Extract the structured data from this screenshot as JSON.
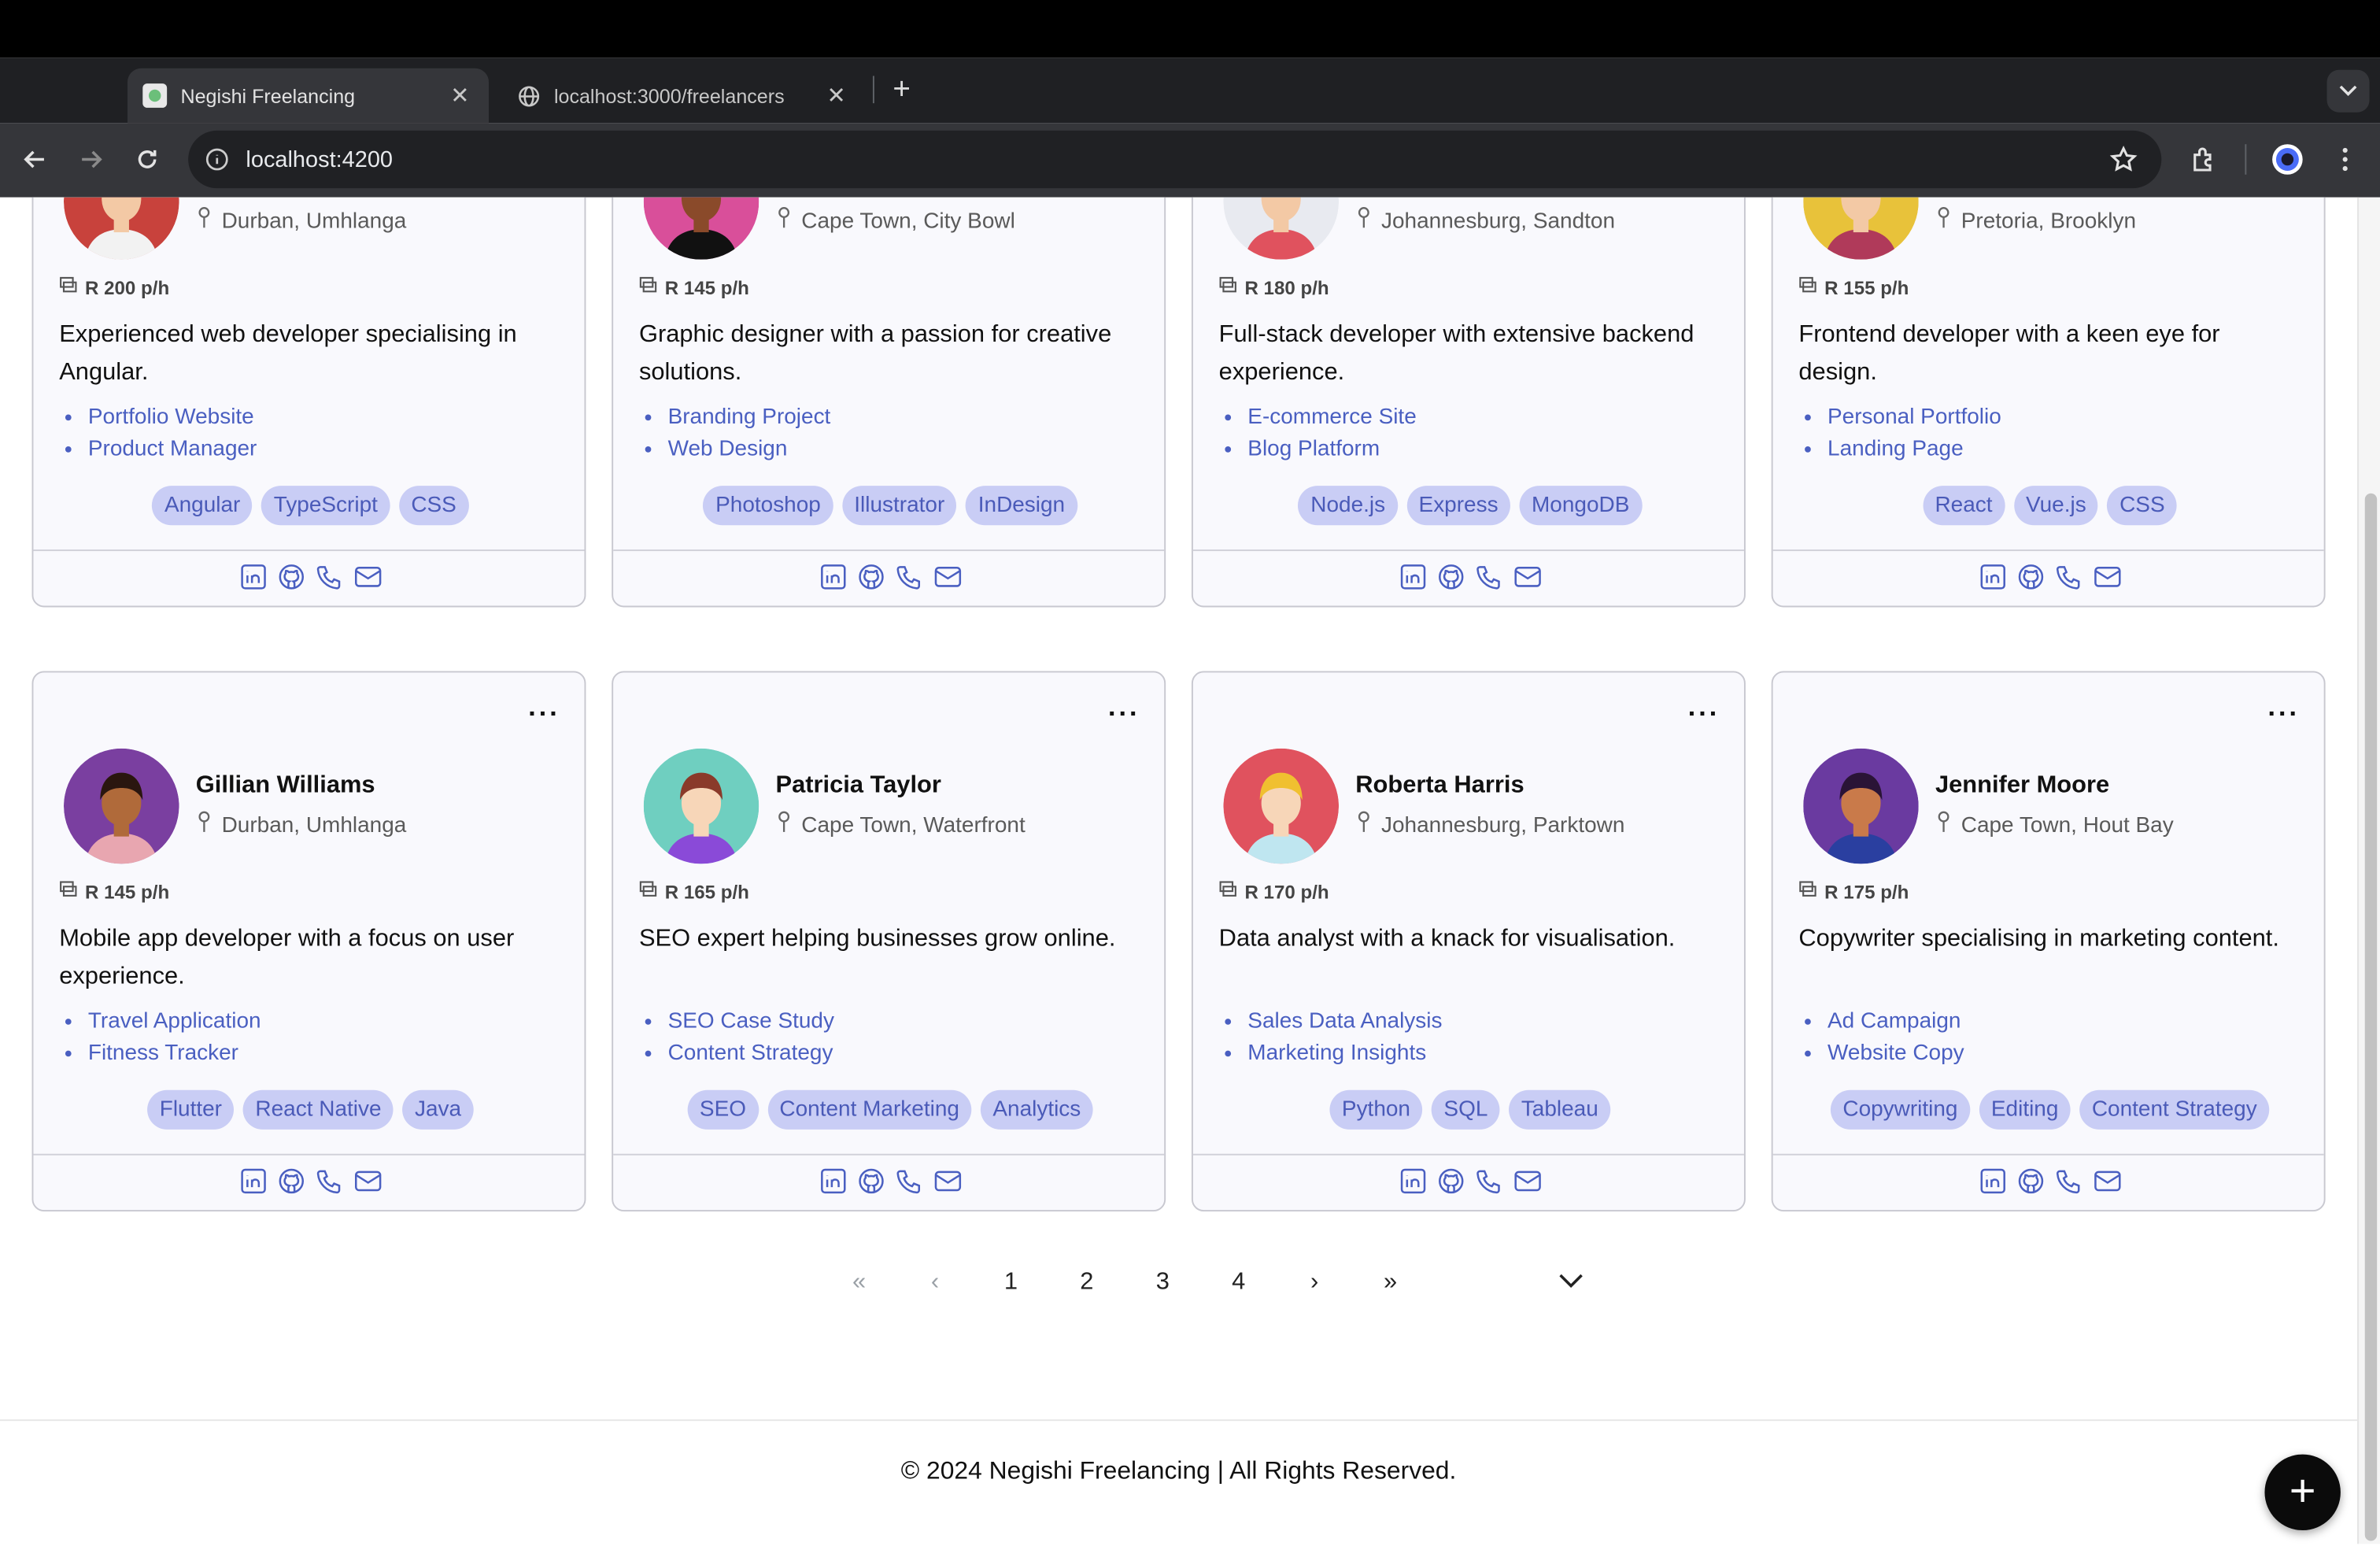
{
  "browser": {
    "tabs": [
      {
        "title": "Negishi Freelancing",
        "active": true
      },
      {
        "title": "localhost:3000/freelancers",
        "active": false
      }
    ],
    "url": "localhost:4200"
  },
  "cards": [
    {
      "name": "",
      "location": "Durban, Umhlanga",
      "rate": "R 200 p/h",
      "description": "Experienced web developer specialising in Angular.",
      "projects": [
        "Portfolio Website",
        "Product Manager"
      ],
      "skills": [
        "Angular",
        "TypeScript",
        "CSS"
      ],
      "avatar_color": "#c8423c"
    },
    {
      "name": "",
      "location": "Cape Town, City Bowl",
      "rate": "R 145 p/h",
      "description": "Graphic designer with a passion for creative solutions.",
      "projects": [
        "Branding Project",
        "Web Design"
      ],
      "skills": [
        "Photoshop",
        "Illustrator",
        "InDesign"
      ],
      "avatar_color": "#d94f9a"
    },
    {
      "name": "",
      "location": "Johannesburg, Sandton",
      "rate": "R 180 p/h",
      "description": "Full-stack developer with extensive backend experience.",
      "projects": [
        "E-commerce Site",
        "Blog Platform"
      ],
      "skills": [
        "Node.js",
        "Express",
        "MongoDB"
      ],
      "avatar_color": "#e8eaf0"
    },
    {
      "name": "",
      "location": "Pretoria, Brooklyn",
      "rate": "R 155 p/h",
      "description": "Frontend developer with a keen eye for design.",
      "projects": [
        "Personal Portfolio",
        "Landing Page"
      ],
      "skills": [
        "React",
        "Vue.js",
        "CSS"
      ],
      "avatar_color": "#e8c23a"
    },
    {
      "name": "Gillian Williams",
      "location": "Durban, Umhlanga",
      "rate": "R 145 p/h",
      "description": "Mobile app developer with a focus on user experience.",
      "projects": [
        "Travel Application",
        "Fitness Tracker"
      ],
      "skills": [
        "Flutter",
        "React Native",
        "Java"
      ],
      "avatar_color": "#7a3fa0"
    },
    {
      "name": "Patricia Taylor",
      "location": "Cape Town, Waterfront",
      "rate": "R 165 p/h",
      "description": "SEO expert helping businesses grow online.",
      "projects": [
        "SEO Case Study",
        "Content Strategy"
      ],
      "skills": [
        "SEO",
        "Content Marketing",
        "Analytics"
      ],
      "avatar_color": "#6fcfc0"
    },
    {
      "name": "Roberta Harris",
      "location": "Johannesburg, Parktown",
      "rate": "R 170 p/h",
      "description": "Data analyst with a knack for visualisation.",
      "projects": [
        "Sales Data Analysis",
        "Marketing Insights"
      ],
      "skills": [
        "Python",
        "SQL",
        "Tableau"
      ],
      "avatar_color": "#e0525e"
    },
    {
      "name": "Jennifer Moore",
      "location": "Cape Town, Hout Bay",
      "rate": "R 175 p/h",
      "description": "Copywriter specialising in marketing content.",
      "projects": [
        "Ad Campaign",
        "Website Copy"
      ],
      "skills": [
        "Copywriting",
        "Editing",
        "Content Strategy"
      ],
      "avatar_color": "#6a3aa0"
    }
  ],
  "pagination": {
    "first": "«",
    "prev": "‹",
    "pages": [
      "1",
      "2",
      "3",
      "4"
    ],
    "next": "›",
    "last": "»"
  },
  "footer": "© 2024 Negishi Freelancing | All Rights Reserved.",
  "fab_label": "+"
}
